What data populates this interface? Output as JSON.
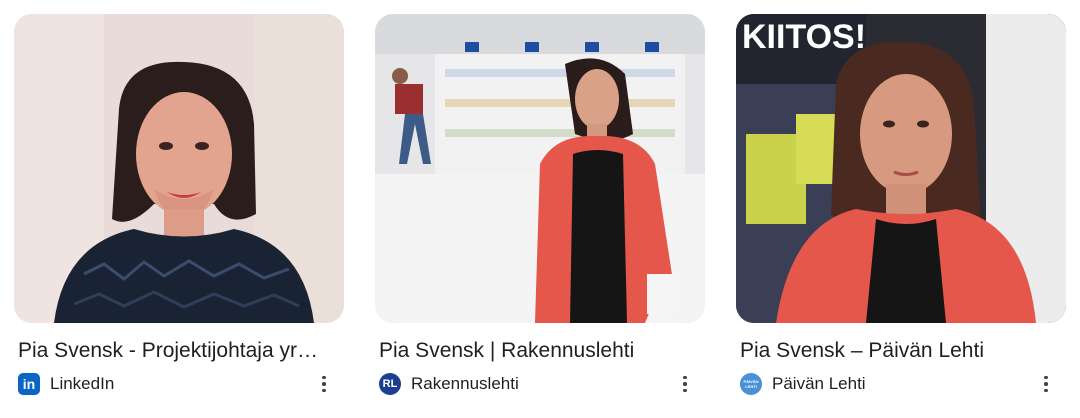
{
  "results": [
    {
      "title": "Pia Svensk - Projektijohtaja yr…",
      "source": "LinkedIn",
      "favicon": "linkedin-icon",
      "favicon_text": "in",
      "favicon_color": "#0a66c2"
    },
    {
      "title": "Pia Svensk | Rakennuslehti",
      "source": "Rakennuslehti",
      "favicon": "rakennuslehti-icon",
      "favicon_text": "RL",
      "favicon_color": "#1d3f8f"
    },
    {
      "title": "Pia Svensk – Päivän Lehti",
      "source": "Päivän Lehti",
      "favicon": "paivan-lehti-icon",
      "favicon_text": "PÄIVÄN LEHTI",
      "favicon_color": "#4a90d9"
    }
  ],
  "images": [
    {
      "background_sign_text": ""
    },
    {
      "background_sign_text": ""
    },
    {
      "background_sign_text": "KIITOS!"
    }
  ],
  "colors": {
    "text": "#1f1f1f",
    "more_icon": "#444444",
    "jacket_red": "#e4574a"
  }
}
